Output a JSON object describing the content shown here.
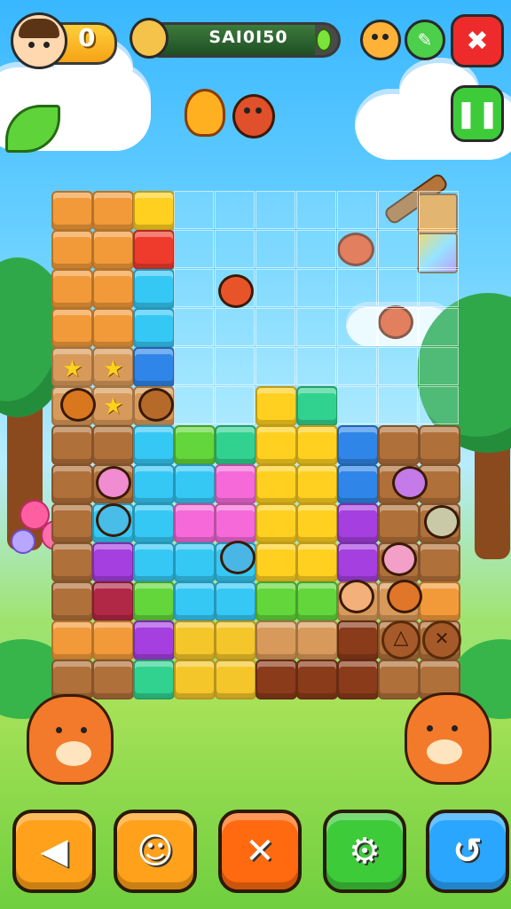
{
  "hud": {
    "coins_value": "0",
    "score_text": "SAI0I50",
    "score_fill": 0.88
  },
  "icons": {
    "avatar": "player-avatar-icon",
    "sack": "coin-sack-icon",
    "bear": "bear-face-icon",
    "edit": "pencil-icon",
    "close": "close-icon",
    "pause": "pause-icon"
  },
  "controls": [
    {
      "name": "back-button",
      "glyph": "◀",
      "color": "#ffa11a"
    },
    {
      "name": "ghost-button",
      "glyph": "☺",
      "color": "#ffa11a"
    },
    {
      "name": "cancel-button",
      "glyph": "✕",
      "color": "#ff6a10"
    },
    {
      "name": "settings-button",
      "glyph": "⚙",
      "color": "#3ecb3a"
    },
    {
      "name": "undo-button",
      "glyph": "↺",
      "color": "#2aa6ff"
    }
  ],
  "colors": {
    "orange": "#f29a3a",
    "yellow": "#ffd020",
    "red": "#ef3b2c",
    "cyan": "#35c8f4",
    "blue": "#2f86e8",
    "green": "#62d63a",
    "teal": "#31d28f",
    "pink": "#f56ad8",
    "purple": "#a53fe0",
    "brown": "#b0703a",
    "darkbrown": "#8a3b1a",
    "maroon": "#b02845",
    "gold": "#f5c62a",
    "tan": "#d89a5a"
  }
}
